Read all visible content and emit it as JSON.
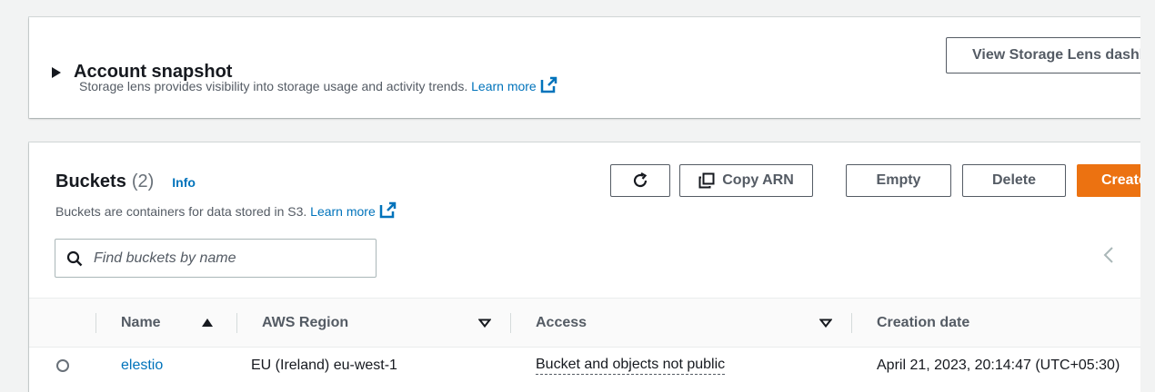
{
  "snapshot": {
    "title": "Account snapshot",
    "description": "Storage lens provides visibility into storage usage and activity trends.",
    "learn_more": "Learn more",
    "view_button": "View Storage Lens dashboard"
  },
  "buckets": {
    "title": "Buckets",
    "count": "(2)",
    "info": "Info",
    "description": "Buckets are containers for data stored in S3.",
    "learn_more": "Learn more",
    "actions": {
      "copy_arn": "Copy ARN",
      "empty": "Empty",
      "delete": "Delete",
      "create": "Create bucket"
    },
    "search_placeholder": "Find buckets by name",
    "columns": {
      "name": "Name",
      "region": "AWS Region",
      "access": "Access",
      "created": "Creation date"
    },
    "rows": [
      {
        "name": "elestio",
        "region": "EU (Ireland) eu-west-1",
        "access": "Bucket and objects not public",
        "created": "April 21, 2023, 20:14:47 (UTC+05:30)"
      }
    ]
  },
  "colors": {
    "primary": "#ec7211",
    "link": "#0073bb",
    "text": "#16191f",
    "muted": "#545b64"
  }
}
